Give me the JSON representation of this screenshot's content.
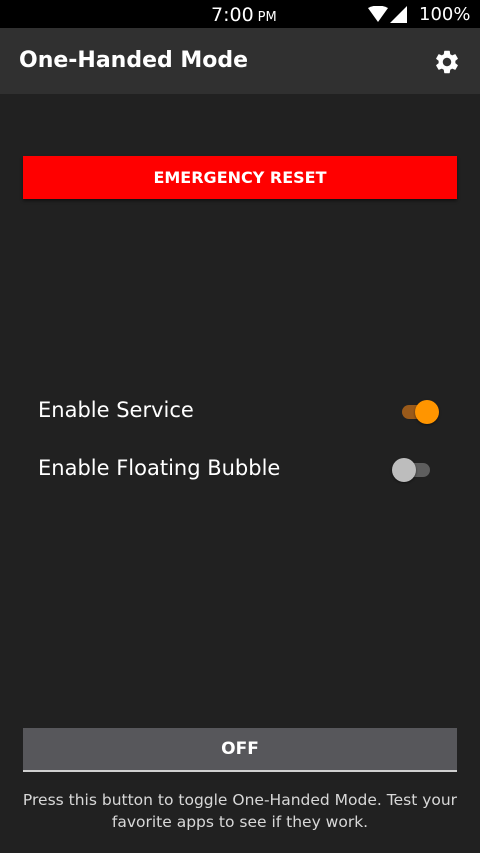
{
  "status_bar": {
    "time": "7:00",
    "ampm": "PM",
    "battery": "100%",
    "icons": [
      "wifi-icon",
      "cell-signal-icon"
    ]
  },
  "app_bar": {
    "title": "One-Handed Mode",
    "settings_icon": "gear-icon"
  },
  "emergency_button": {
    "label": "EMERGENCY RESET",
    "color": "#ff0000"
  },
  "settings": [
    {
      "label": "Enable Service",
      "enabled": true
    },
    {
      "label": "Enable Floating Bubble",
      "enabled": false
    }
  ],
  "toggle_button": {
    "label": "OFF"
  },
  "hint": "Press this button to toggle One-Handed Mode. Test your favorite apps to see if they work.",
  "colors": {
    "accent": "#ff9500",
    "background": "#212121",
    "app_bar": "#303030"
  }
}
